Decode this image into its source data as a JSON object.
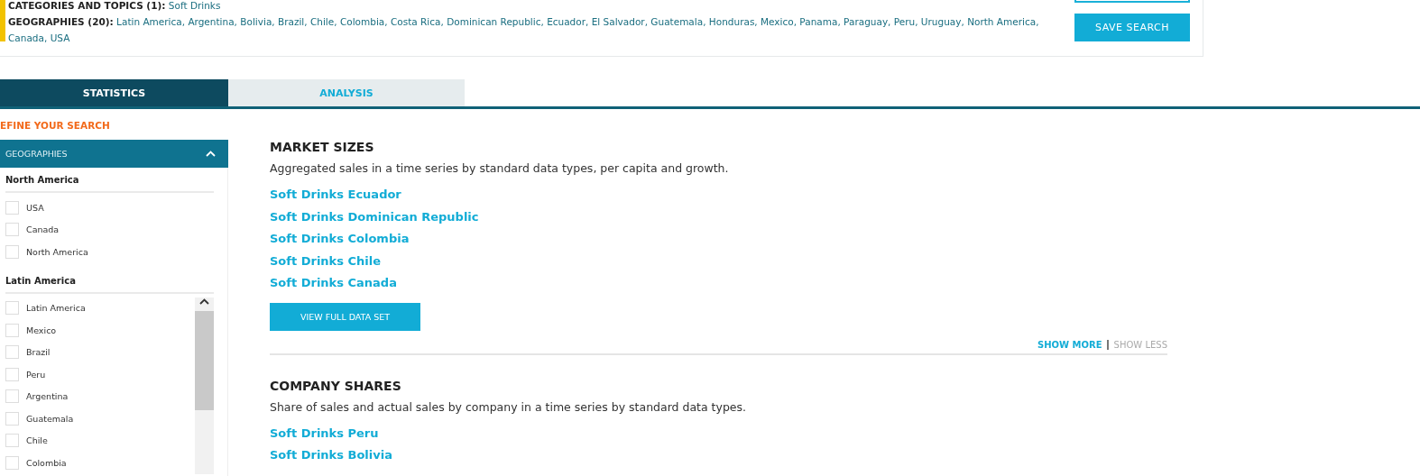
{
  "search_summary": {
    "categories": {
      "label": "CATEGORIES AND TOPICS (1):",
      "value": "Soft Drinks"
    },
    "geographies": {
      "label": "GEOGRAPHIES (20):",
      "value": "Latin America, Argentina, Bolivia, Brazil, Chile, Colombia, Costa Rica, Dominican Republic, Ecuador, El Salvador, Guatemala, Honduras, Mexico, Panama, Paraguay, Peru, Uruguay, North America, Canada, USA"
    },
    "save_button": "SAVE SEARCH"
  },
  "tabs": [
    {
      "label": "STATISTICS",
      "selected": true
    },
    {
      "label": "ANALYSIS",
      "selected": false
    }
  ],
  "sidebar": {
    "title": "EFINE YOUR SEARCH",
    "panel": {
      "title": "GEOGRAPHIES",
      "expanded": true,
      "groups": [
        {
          "title": "North America",
          "scrollable": false,
          "items": [
            {
              "label": "USA",
              "checked": false
            },
            {
              "label": "Canada",
              "checked": false
            },
            {
              "label": "North America",
              "checked": false
            }
          ]
        },
        {
          "title": "Latin America",
          "scrollable": true,
          "items": [
            {
              "label": "Latin America",
              "checked": false
            },
            {
              "label": "Mexico",
              "checked": false
            },
            {
              "label": "Brazil",
              "checked": false
            },
            {
              "label": "Peru",
              "checked": false
            },
            {
              "label": "Argentina",
              "checked": false
            },
            {
              "label": "Guatemala",
              "checked": false
            },
            {
              "label": "Chile",
              "checked": false
            },
            {
              "label": "Colombia",
              "checked": false
            }
          ]
        }
      ]
    }
  },
  "sections": [
    {
      "title": "MARKET SIZES",
      "description": "Aggregated sales in a time series by standard data types, per capita and growth.",
      "links": [
        "Soft Drinks Ecuador",
        "Soft Drinks Dominican Republic",
        "Soft Drinks Colombia",
        "Soft Drinks Chile",
        "Soft Drinks Canada"
      ],
      "button": "VIEW FULL DATA SET",
      "show_more": "SHOW MORE",
      "show_less": "SHOW LESS"
    },
    {
      "title": "COMPANY SHARES",
      "description": "Share of sales and actual sales by company in a time series by standard data types.",
      "links": [
        "Soft Drinks Peru",
        "Soft Drinks Bolivia"
      ]
    }
  ]
}
